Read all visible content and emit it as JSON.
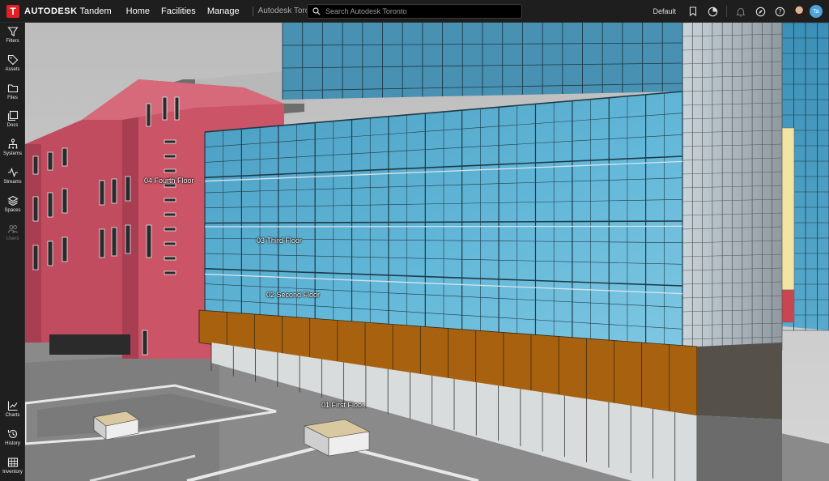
{
  "header": {
    "logo_letter": "T",
    "brand": "AUTODESK",
    "product": "Tandem",
    "nav": [
      "Home",
      "Facilities",
      "Manage"
    ],
    "facility": "Autodesk Toronto",
    "search_placeholder": "Search Autodesk Toronto",
    "view_name": "Default",
    "user_initials": "Ta"
  },
  "sidebar": {
    "top_items": [
      "Filters",
      "Assets",
      "Files",
      "Docs",
      "Systems",
      "Streams",
      "Spaces",
      "Users"
    ],
    "bottom_items": [
      "Charts",
      "History",
      "Inventory"
    ]
  },
  "viewport": {
    "floor_labels": [
      "04 Fourth Floor",
      "03 Third Floor",
      "02 Second Floor",
      "01 First Floor"
    ],
    "colors": {
      "glass": "#5fb2d3",
      "brick": "#c85365",
      "spandrel": "#a8620f",
      "ground": "#8a8a8a",
      "sky": "#c9c9c9"
    }
  }
}
